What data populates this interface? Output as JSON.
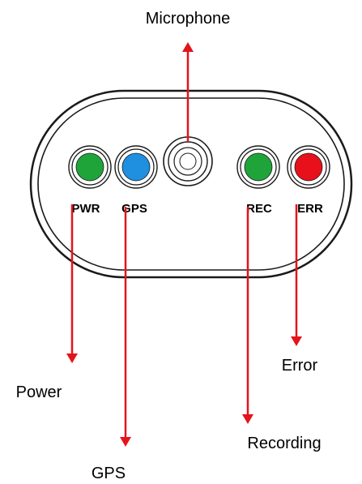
{
  "device": {
    "body_color": "#ffffff",
    "outline_color": "#1a1a1a"
  },
  "leds": [
    {
      "code": "PWR",
      "name": "Power",
      "color": "#1fa43a"
    },
    {
      "code": "GPS",
      "name": "GPS",
      "color": "#1f8fe0"
    },
    {
      "code": "REC",
      "name": "Recording",
      "color": "#1fa43a"
    },
    {
      "code": "ERR",
      "name": "Error",
      "color": "#e8101a"
    }
  ],
  "microphone": {
    "label": "Microphone"
  },
  "arrow_color": "#e4141b"
}
